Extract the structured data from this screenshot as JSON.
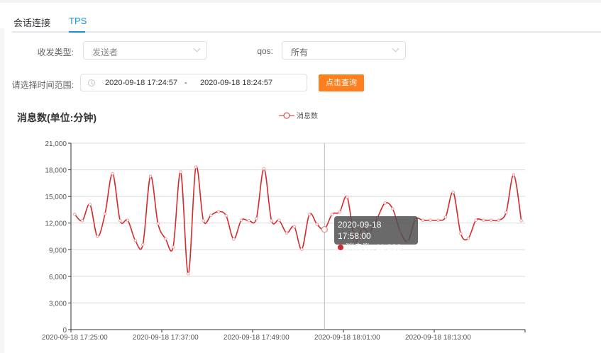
{
  "tabs": [
    {
      "label": "会话连接",
      "active": false
    },
    {
      "label": "TPS",
      "active": true
    }
  ],
  "form": {
    "direction_label": "收发类型:",
    "direction_value": "发送者",
    "qos_label": "qos:",
    "qos_value": "所有",
    "range_label": "请选择时间范围:",
    "range_start": "2020-09-18 17:24:57",
    "range_sep": "-",
    "range_end": "2020-09-18 18:24:57",
    "query_button": "点击查询"
  },
  "colors": {
    "accent": "#1890d8",
    "button": "#ff7f1f",
    "series": "#d42a2a"
  },
  "tooltip": {
    "time": "2020-09-18 17:58:00",
    "series": "消息数",
    "value": "11,288"
  },
  "chart_data": {
    "type": "line",
    "title": "消息数(单位:分钟)",
    "legend": [
      "消息数"
    ],
    "legend_position": "top-center",
    "ylim": [
      0,
      21000
    ],
    "yticks": [
      "0",
      "3,000",
      "6,000",
      "9,000",
      "12,000",
      "15,000",
      "18,000",
      "21,000"
    ],
    "xtick_labels": [
      "2020-09-18 17:25:00",
      "2020-09-18 17:37:00",
      "2020-09-18 17:49:00",
      "2020-09-18 18:01:00",
      "2020-09-18 18:13:00"
    ],
    "x_start": "2020-09-18 17:25:00",
    "x_step_minutes": 1,
    "series": [
      {
        "name": "消息数",
        "values": [
          12985,
          12270,
          14100,
          10490,
          13040,
          17570,
          12270,
          12320,
          10040,
          9570,
          17280,
          11930,
          10230,
          9300,
          17760,
          6280,
          18310,
          12270,
          12880,
          13300,
          12830,
          10200,
          12320,
          12270,
          12510,
          18130,
          12270,
          12320,
          10890,
          11610,
          9060,
          12985,
          11870,
          11288,
          12985,
          13250,
          14920,
          10040,
          11400,
          11000,
          12610,
          14260,
          13620,
          11080,
          9960,
          12400,
          12320,
          12320,
          12320,
          12670,
          15480,
          10810,
          10280,
          12320,
          12320,
          12320,
          12320,
          13200,
          17440,
          12270
        ]
      }
    ],
    "highlight_index": 33,
    "grid": true
  }
}
